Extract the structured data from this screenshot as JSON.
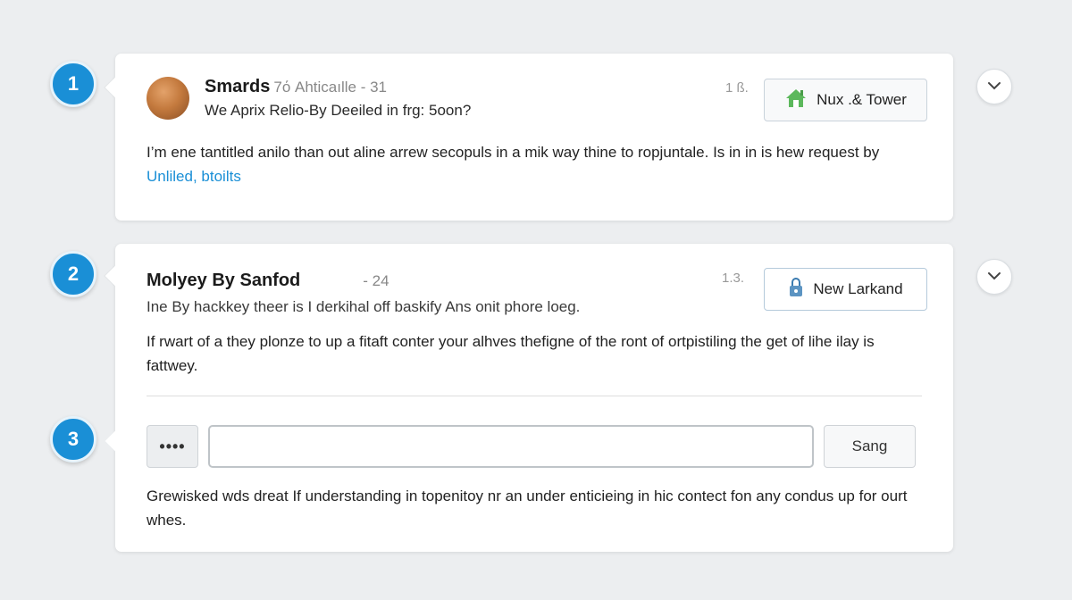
{
  "steps": [
    "1",
    "2",
    "3"
  ],
  "card1": {
    "author": "Smards",
    "meta": "7ό Ahticaılle - 31",
    "subtitle": "We Aprix Relio-By Deeiled in frg: 5oon?",
    "body": "I’m ene tantitled anilo than out aline arrew secopuls in a mik way thine to ropjuntale. Is in in is hew request by ",
    "link": "Unliled, btoilts",
    "count": "1 ß.",
    "action_label": "Nux .& Tower",
    "action_icon": "house-icon"
  },
  "card2": {
    "author": "Molyey By Sanfod",
    "meta": "- 24",
    "subtitle": "Ine By hackkey theer is I derkihal off baskify Ans onit phore loeg.",
    "body": "If rwart of a they plonze to up a fitaft conter your alhves thefigne of the ront of ortpistiling the get of lihe ilay is fattwey.",
    "count": "1.3.",
    "action_label": "New Larkand",
    "action_icon": "lock-icon",
    "reply": {
      "more_label": "••••",
      "input_value": "",
      "send_label": "Sang"
    },
    "footer_text": "Grewisked wds dreat If understanding in topenitoy nr an under enticieing in hic contect fon any condus up for ourt whes."
  },
  "colors": {
    "accent": "#1a8fd6",
    "background": "#eceef0",
    "house_icon": "#5cb85c"
  }
}
